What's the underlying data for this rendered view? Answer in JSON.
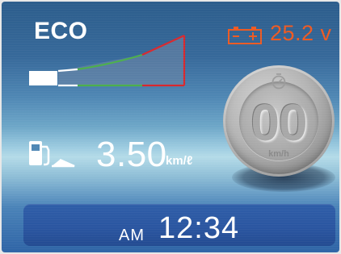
{
  "mode": {
    "label": "ECO"
  },
  "battery": {
    "voltage": "25.2 v",
    "icon": "battery-icon",
    "color": "#ee5a22"
  },
  "fuel_economy": {
    "value": "3.50",
    "unit": "km/ℓ",
    "icon": "fuel-pump-icon"
  },
  "speed": {
    "value": "00",
    "unit": "km/h",
    "icon": "speed-icon"
  },
  "clock": {
    "ampm": "AM",
    "time": "12:34"
  },
  "colors": {
    "eco_green": "#4caf4c",
    "eco_red": "#d8282e",
    "clock_bar": "#2a55a0",
    "text": "#ffffff"
  }
}
